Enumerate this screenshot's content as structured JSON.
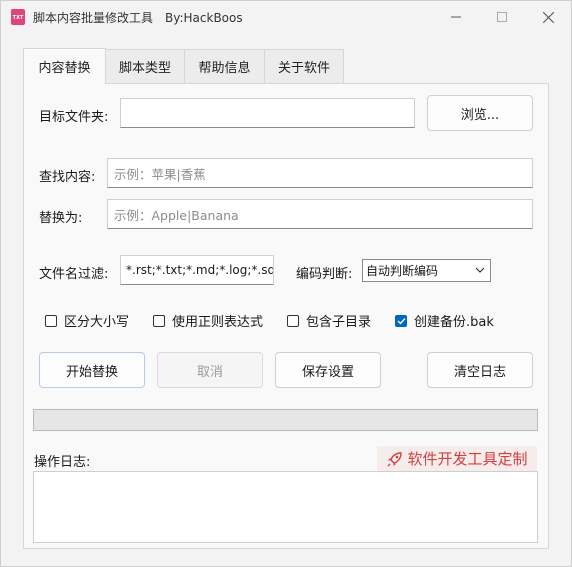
{
  "window": {
    "app_icon_text": "TXT",
    "title": "脚本内容批量修改工具",
    "author": "By:HackBoos"
  },
  "tabs": [
    {
      "label": "内容替换",
      "active": true
    },
    {
      "label": "脚本类型",
      "active": false
    },
    {
      "label": "帮助信息",
      "active": false
    },
    {
      "label": "关于软件",
      "active": false
    }
  ],
  "form": {
    "target_folder": {
      "label": "目标文件夹:",
      "value": "",
      "browse_label": "浏览..."
    },
    "find": {
      "label": "查找内容:",
      "placeholder": "示例：苹果|香蕉"
    },
    "replace": {
      "label": "替换为:",
      "placeholder": "示例：Apple|Banana"
    },
    "filename_filter": {
      "label": "文件名过滤:",
      "value": "*.rst;*.txt;*.md;*.log;*.sql"
    },
    "encoding": {
      "label": "编码判断:",
      "selected": "自动判断编码"
    }
  },
  "options": [
    {
      "label": "区分大小写",
      "checked": false
    },
    {
      "label": "使用正则表达式",
      "checked": false
    },
    {
      "label": "包含子目录",
      "checked": false
    },
    {
      "label": "创建备份.bak",
      "checked": true
    }
  ],
  "actions": {
    "start": "开始替换",
    "cancel": "取消",
    "save": "保存设置",
    "clear_log": "清空日志"
  },
  "progress": {
    "value": 0
  },
  "log": {
    "label": "操作日志:",
    "custom_link": "软件开发工具定制",
    "content": ""
  },
  "colors": {
    "accent": "#0067c0",
    "link": "#d24141",
    "progress_fill": "#06b025"
  }
}
